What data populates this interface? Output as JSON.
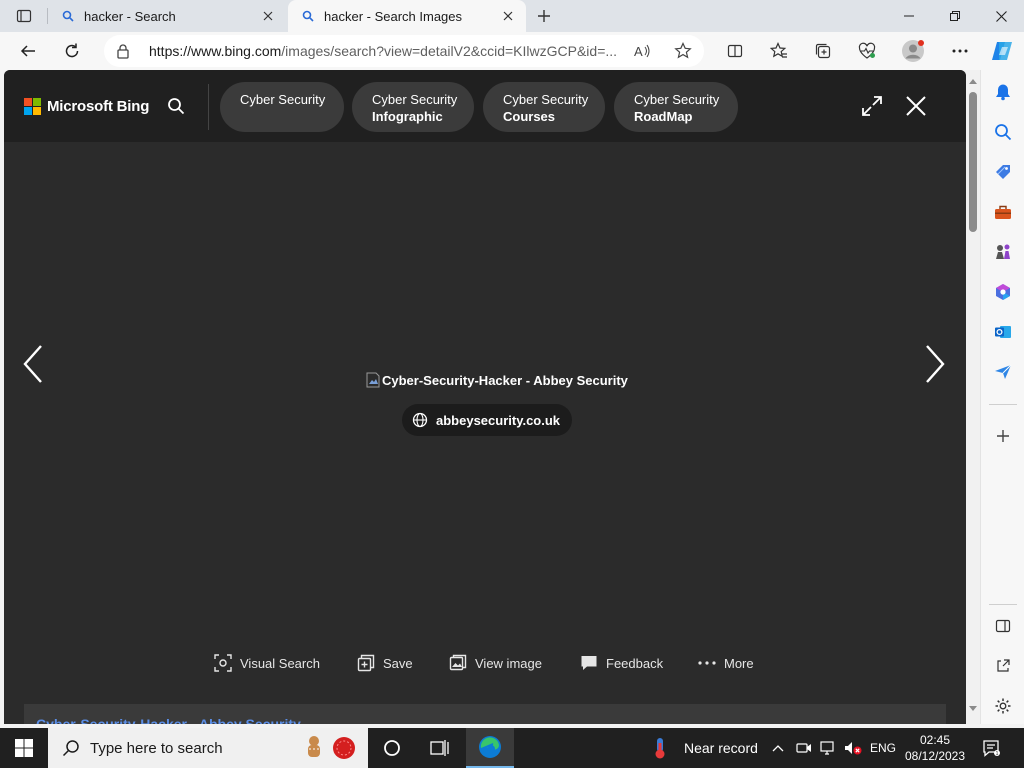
{
  "tabs": [
    {
      "label": "hacker - Search",
      "active": false
    },
    {
      "label": "hacker - Search Images",
      "active": true
    }
  ],
  "address_bar": {
    "url_host": "https://www.bing.com",
    "url_path": "/images/search?view=detailV2&ccid=KIlwzGCP&id=..."
  },
  "bing": {
    "brand": "Microsoft Bing",
    "related_pills": [
      {
        "line1": "Cyber Security",
        "line2": ""
      },
      {
        "line1": "Cyber Security",
        "line2": "Infographic"
      },
      {
        "line1": "Cyber Security",
        "line2": "Courses"
      },
      {
        "line1": "Cyber Security",
        "line2": "RoadMap"
      }
    ],
    "image_alt": "Cyber-Security-Hacker - Abbey Security",
    "source_domain": "abbeysecurity.co.uk",
    "actions": {
      "visual_search": "Visual Search",
      "save": "Save",
      "view_image": "View image",
      "feedback": "Feedback",
      "more": "More"
    },
    "result_title": "Cyber-Security-Hacker - Abbey Security"
  },
  "taskbar": {
    "search_placeholder": "Type here to search",
    "weather": "Near record",
    "language": "ENG",
    "time": "02:45",
    "date": "08/12/2023"
  },
  "colors": {
    "bing_red": "#f25022",
    "bing_green": "#7fba00",
    "bing_blue": "#00a4ef",
    "bing_yellow": "#ffb900",
    "overlay_bg": "#2b2b2b"
  }
}
